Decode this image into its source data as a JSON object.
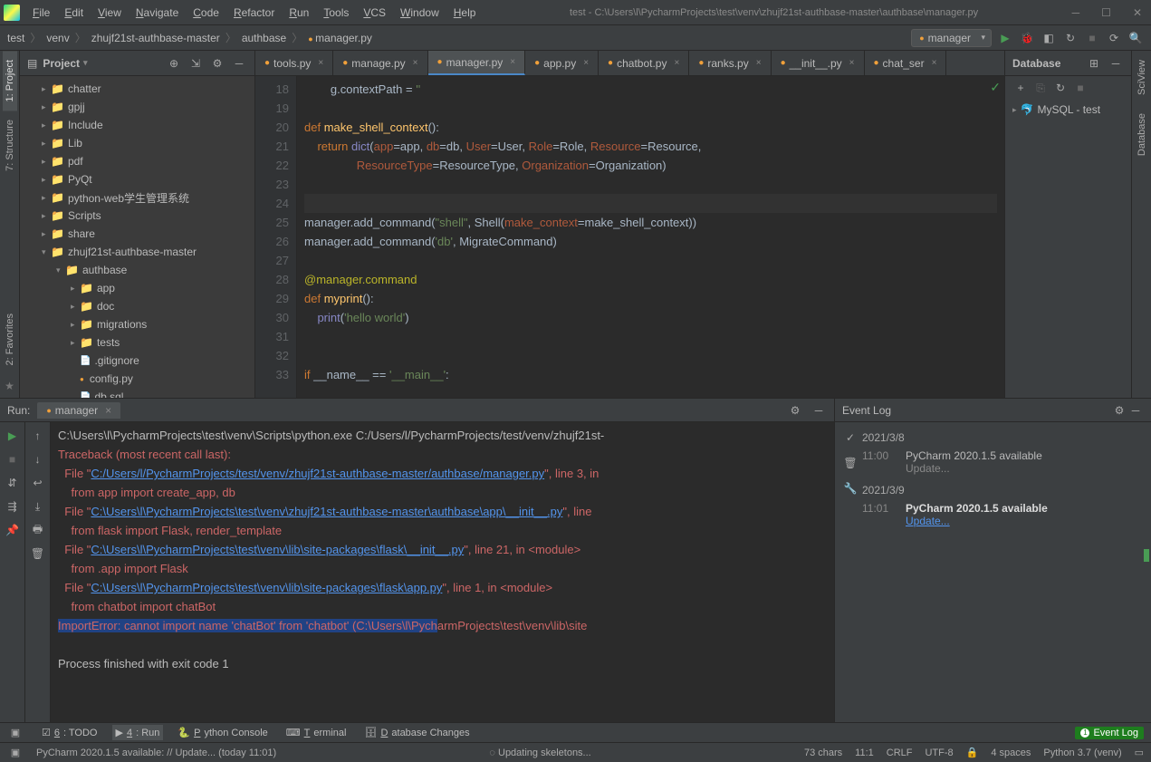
{
  "title_path": "test - C:\\Users\\l\\PycharmProjects\\test\\venv\\zhujf21st-authbase-master\\authbase\\manager.py",
  "menus": [
    "File",
    "Edit",
    "View",
    "Navigate",
    "Code",
    "Refactor",
    "Run",
    "Tools",
    "VCS",
    "Window",
    "Help"
  ],
  "breadcrumbs": [
    "test",
    "venv",
    "zhujf21st-authbase-master",
    "authbase",
    "manager.py"
  ],
  "run_config_label": "manager",
  "run_tools": [
    "play",
    "bug",
    "coverage",
    "attach",
    "stop",
    "build",
    "search"
  ],
  "project_label": "Project",
  "tree": [
    {
      "indent": 1,
      "type": "folder",
      "arrow": "▸",
      "label": "chatter"
    },
    {
      "indent": 1,
      "type": "folder",
      "arrow": "▸",
      "label": "gpjj"
    },
    {
      "indent": 1,
      "type": "folder",
      "arrow": "▸",
      "label": "Include"
    },
    {
      "indent": 1,
      "type": "folder",
      "arrow": "▸",
      "label": "Lib"
    },
    {
      "indent": 1,
      "type": "folder",
      "arrow": "▸",
      "label": "pdf"
    },
    {
      "indent": 1,
      "type": "folder",
      "arrow": "▸",
      "label": "PyQt"
    },
    {
      "indent": 1,
      "type": "folder",
      "arrow": "▸",
      "label": "python-web学生管理系统"
    },
    {
      "indent": 1,
      "type": "folder",
      "arrow": "▸",
      "label": "Scripts"
    },
    {
      "indent": 1,
      "type": "folder",
      "arrow": "▸",
      "label": "share"
    },
    {
      "indent": 1,
      "type": "folder",
      "arrow": "▾",
      "label": "zhujf21st-authbase-master"
    },
    {
      "indent": 2,
      "type": "folder",
      "arrow": "▾",
      "label": "authbase"
    },
    {
      "indent": 3,
      "type": "folder",
      "arrow": "▸",
      "label": "app"
    },
    {
      "indent": 3,
      "type": "folder",
      "arrow": "▸",
      "label": "doc"
    },
    {
      "indent": 3,
      "type": "folder",
      "arrow": "▸",
      "label": "migrations"
    },
    {
      "indent": 3,
      "type": "folder",
      "arrow": "▸",
      "label": "tests"
    },
    {
      "indent": 3,
      "type": "file",
      "arrow": " ",
      "label": ".gitignore"
    },
    {
      "indent": 3,
      "type": "pyfile",
      "arrow": " ",
      "label": "config.py"
    },
    {
      "indent": 3,
      "type": "file",
      "arrow": " ",
      "label": "db.sql"
    }
  ],
  "tabs": [
    {
      "label": "tools.py",
      "active": false
    },
    {
      "label": "manage.py",
      "active": false
    },
    {
      "label": "manager.py",
      "active": true
    },
    {
      "label": "app.py",
      "active": false
    },
    {
      "label": "chatbot.py",
      "active": false
    },
    {
      "label": "ranks.py",
      "active": false
    },
    {
      "label": "__init__.py",
      "active": false
    },
    {
      "label": "chat_ser",
      "active": false
    }
  ],
  "db_panel_title": "Database",
  "db_datasource": "MySQL - test",
  "code_start_line": 18,
  "code_lines": [
    {
      "n": 18,
      "raw": "        g.contextPath = ''",
      "segs": [
        [
          "plain",
          "        g.contextPath = "
        ],
        [
          "str",
          "''"
        ]
      ]
    },
    {
      "n": 19,
      "raw": "",
      "segs": []
    },
    {
      "n": 20,
      "raw": "def make_shell_context():",
      "segs": [
        [
          "kw",
          "def "
        ],
        [
          "fn",
          "make_shell_context"
        ],
        [
          "plain",
          "():"
        ]
      ]
    },
    {
      "n": 21,
      "raw": "    return dict(app=app, db=db, User=User, Role=Role, Resource=Resource,",
      "segs": [
        [
          "plain",
          "    "
        ],
        [
          "kw",
          "return "
        ],
        [
          "bi",
          "dict"
        ],
        [
          "plain",
          "("
        ],
        [
          "param",
          "app"
        ],
        [
          "plain",
          "=app, "
        ],
        [
          "param",
          "db"
        ],
        [
          "plain",
          "=db, "
        ],
        [
          "param",
          "User"
        ],
        [
          "plain",
          "=User, "
        ],
        [
          "param",
          "Role"
        ],
        [
          "plain",
          "=Role, "
        ],
        [
          "param",
          "Resource"
        ],
        [
          "plain",
          "=Resource,"
        ]
      ]
    },
    {
      "n": 22,
      "raw": "                ResourceType=ResourceType, Organization=Organization)",
      "segs": [
        [
          "plain",
          "                "
        ],
        [
          "param",
          "ResourceType"
        ],
        [
          "plain",
          "=ResourceType, "
        ],
        [
          "param",
          "Organization"
        ],
        [
          "plain",
          "=Organization)"
        ]
      ]
    },
    {
      "n": 23,
      "raw": "",
      "segs": []
    },
    {
      "n": 24,
      "raw": "",
      "hl": true,
      "segs": []
    },
    {
      "n": 25,
      "raw": "manager.add_command(\"shell\", Shell(make_context=make_shell_context))",
      "segs": [
        [
          "plain",
          "manager.add_command("
        ],
        [
          "str",
          "\"shell\""
        ],
        [
          "plain",
          ", Shell("
        ],
        [
          "param",
          "make_context"
        ],
        [
          "plain",
          "=make_shell_context))"
        ]
      ]
    },
    {
      "n": 26,
      "raw": "manager.add_command('db', MigrateCommand)",
      "segs": [
        [
          "plain",
          "manager.add_command("
        ],
        [
          "str",
          "'db'"
        ],
        [
          "plain",
          ", MigrateCommand)"
        ]
      ]
    },
    {
      "n": 27,
      "raw": "",
      "segs": []
    },
    {
      "n": 28,
      "raw": "@manager.command",
      "segs": [
        [
          "dec",
          "@manager.command"
        ]
      ]
    },
    {
      "n": 29,
      "raw": "def myprint():",
      "segs": [
        [
          "kw",
          "def "
        ],
        [
          "fn",
          "myprint"
        ],
        [
          "plain",
          "():"
        ]
      ]
    },
    {
      "n": 30,
      "raw": "    print('hello world')",
      "segs": [
        [
          "plain",
          "    "
        ],
        [
          "bi",
          "print"
        ],
        [
          "plain",
          "("
        ],
        [
          "str",
          "'hello world'"
        ],
        [
          "plain",
          ")"
        ]
      ]
    },
    {
      "n": 31,
      "raw": "",
      "segs": []
    },
    {
      "n": 32,
      "raw": "",
      "segs": []
    },
    {
      "n": 33,
      "raw": "if __name__ == '__main__':",
      "segs": [
        [
          "kw",
          "if "
        ],
        [
          "plain",
          "__name__ == "
        ],
        [
          "str",
          "'__main__'"
        ],
        [
          "plain",
          ":"
        ]
      ]
    }
  ],
  "run_label": "Run:",
  "run_tab_label": "manager",
  "console": {
    "cmd": "C:\\Users\\l\\PycharmProjects\\test\\venv\\Scripts\\python.exe C:/Users/l/PycharmProjects/test/venv/zhujf21st-",
    "traceback": "Traceback (most recent call last):",
    "lines": [
      {
        "prefix": "  File \"",
        "link": "C:/Users/l/PycharmProjects/test/venv/zhujf21st-authbase-master/authbase/manager.py",
        "suffix": "\", line 3, in"
      },
      {
        "full": "    from app import create_app, db"
      },
      {
        "prefix": "  File \"",
        "link": "C:\\Users\\l\\PycharmProjects\\test\\venv\\zhujf21st-authbase-master\\authbase\\app\\__init__.py",
        "suffix": "\", line"
      },
      {
        "full": "    from flask import Flask, render_template"
      },
      {
        "prefix": "  File \"",
        "link": "C:\\Users\\l\\PycharmProjects\\test\\venv\\lib\\site-packages\\flask\\__init__.py",
        "suffix": "\", line 21, in <module>"
      },
      {
        "full": "    from .app import Flask"
      },
      {
        "prefix": "  File \"",
        "link": "C:\\Users\\l\\PycharmProjects\\test\\venv\\lib\\site-packages\\flask\\app.py",
        "suffix": "\", line 1, in <module>"
      },
      {
        "full": "    from chatbot import chatBot"
      }
    ],
    "error_sel": "ImportError: cannot import name 'chatBot' from 'chatbot' (C:\\Users\\l\\Pych",
    "error_tail": "armProjects\\test\\venv\\lib\\site",
    "exit": "Process finished with exit code 1"
  },
  "event_log_title": "Event Log",
  "event_entries": [
    {
      "date": "2021/3/8"
    },
    {
      "time": "11:00",
      "msg": "PyCharm 2020.1.5 available",
      "link": "Update...",
      "bold": false
    },
    {
      "date": "2021/3/9"
    },
    {
      "time": "11:01",
      "msg": "PyCharm 2020.1.5 available",
      "link": "Update...",
      "bold": true,
      "linkblue": true
    }
  ],
  "bottom_tabs": [
    {
      "label": "6: TODO"
    },
    {
      "label": "4: Run",
      "active": true
    },
    {
      "label": "Python Console"
    },
    {
      "label": "Terminal"
    },
    {
      "label": "Database Changes"
    }
  ],
  "event_log_btn": "Event Log",
  "status_left": "PyCharm 2020.1.5 available: // Update... (today 11:01)",
  "status_progress": "Updating skeletons...",
  "status_chars": "73 chars",
  "status_line": "11:1",
  "status_crlf": "CRLF",
  "status_enc": "UTF-8",
  "status_spaces": "4 spaces",
  "status_python": "Python 3.7 (venv)",
  "side_tabs_left": [
    {
      "label": "1: Project",
      "active": true
    },
    {
      "label": "7: Structure",
      "active": false
    },
    {
      "label": "2: Favorites",
      "active": false
    }
  ],
  "side_tabs_right": [
    {
      "label": "SciView",
      "active": false
    },
    {
      "label": "Database",
      "active": false
    }
  ]
}
